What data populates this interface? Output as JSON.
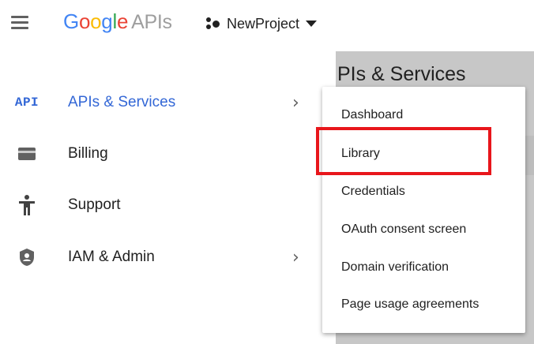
{
  "header": {
    "logo_parts": [
      "G",
      "o",
      "o",
      "g",
      "l",
      "e"
    ],
    "logo_suffix": "APIs",
    "project_name": "NewProject"
  },
  "background": {
    "section_title": "PIs & Services"
  },
  "nav": {
    "items": [
      {
        "icon": "api-icon",
        "label": "APIs & Services",
        "has_submenu": true,
        "active": true
      },
      {
        "icon": "billing-icon",
        "label": "Billing",
        "has_submenu": false
      },
      {
        "icon": "support-icon",
        "label": "Support",
        "has_submenu": false
      },
      {
        "icon": "iam-shield-icon",
        "label": "IAM & Admin",
        "has_submenu": true
      }
    ],
    "api_icon_text": "API"
  },
  "submenu": {
    "items": [
      {
        "label": "Dashboard"
      },
      {
        "label": "Library",
        "highlighted": true
      },
      {
        "label": "Credentials"
      },
      {
        "label": "OAuth consent screen"
      },
      {
        "label": "Domain verification"
      },
      {
        "label": "Page usage agreements"
      }
    ]
  },
  "colors": {
    "accent_blue": "#3367d6",
    "highlight_red": "#e8161b",
    "overlay_grey": "#c7c7c7"
  }
}
